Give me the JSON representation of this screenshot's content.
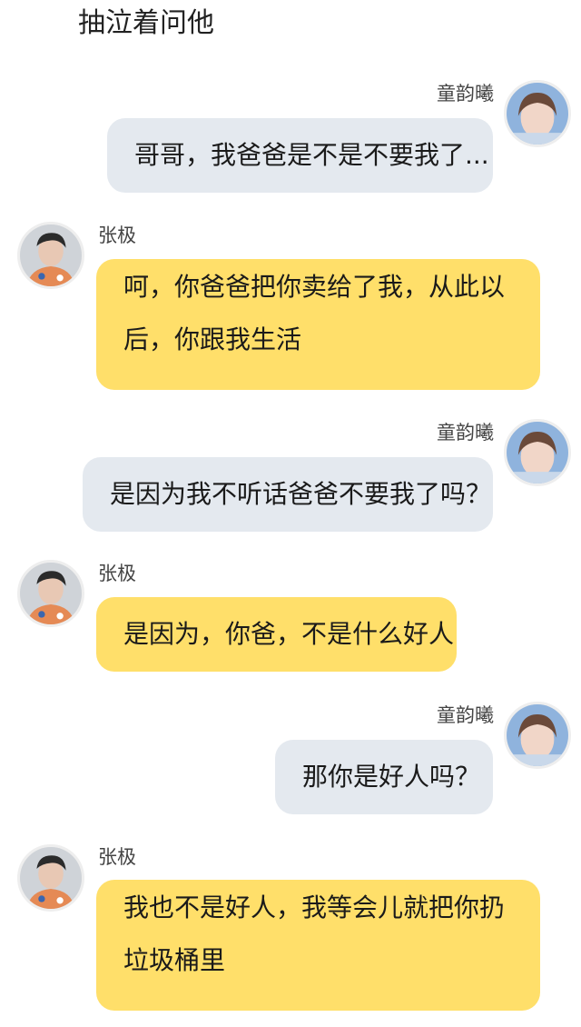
{
  "narration": "抽泣着问他",
  "names": {
    "girl": "童韵曦",
    "boy": "张极"
  },
  "colors": {
    "girl_bubble": "#e4e9ef",
    "boy_bubble": "#ffdf6a",
    "background": "#ffffff"
  },
  "messages": [
    {
      "sender": "童韵曦",
      "side": "right",
      "text": "哥哥，我爸爸是不是不要我了..."
    },
    {
      "sender": "张极",
      "side": "left",
      "text": "呵，你爸爸把你卖给了我，从此以后，你跟我生活"
    },
    {
      "sender": "童韵曦",
      "side": "right",
      "text": "是因为我不听话爸爸不要我了吗？"
    },
    {
      "sender": "张极",
      "side": "left",
      "text": "是因为，你爸，不是什么好人"
    },
    {
      "sender": "童韵曦",
      "side": "right",
      "text": "那你是好人吗？"
    },
    {
      "sender": "张极",
      "side": "left",
      "text": "我也不是好人，我等会儿就把你扔垃圾桶里"
    }
  ]
}
